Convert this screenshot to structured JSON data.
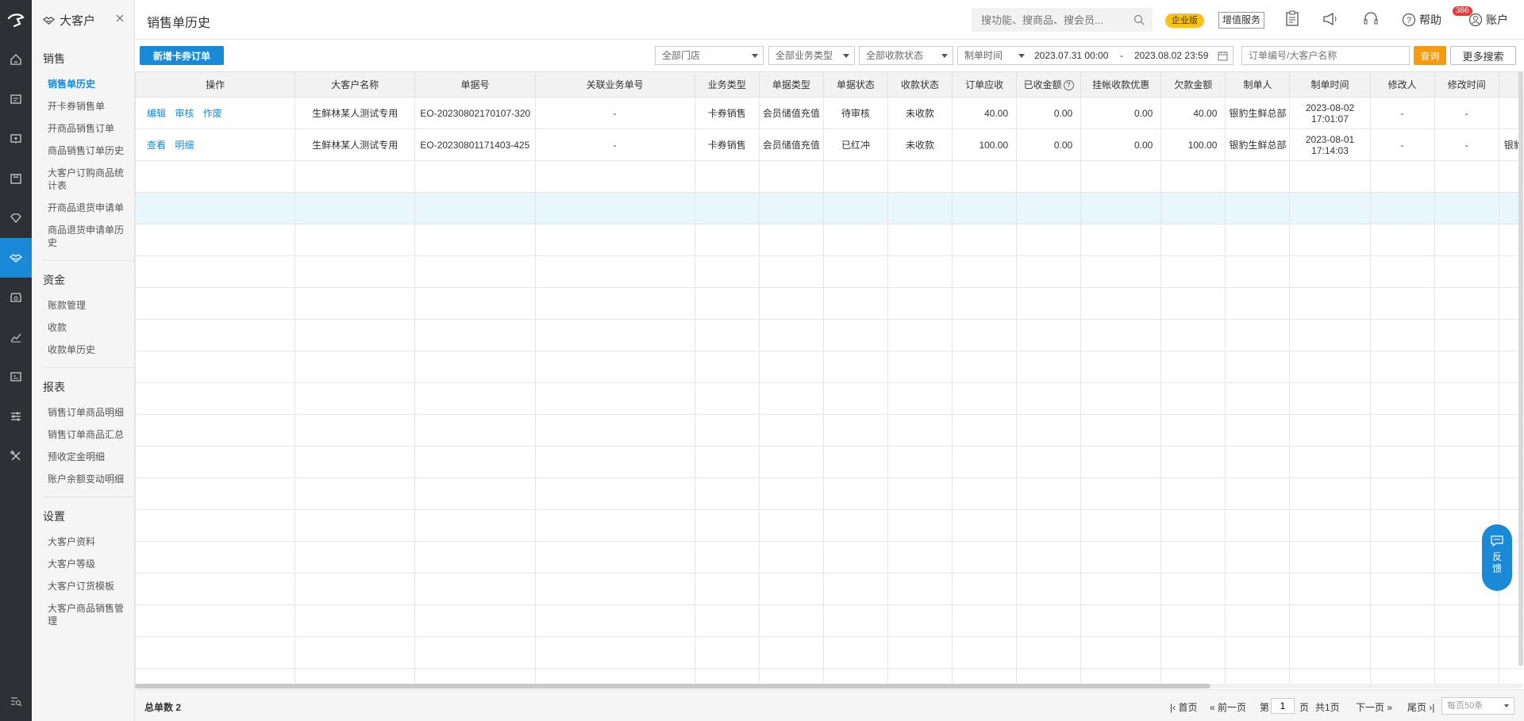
{
  "sidebar": {
    "header_title": "大客户",
    "groups": [
      {
        "title": "销售",
        "items": [
          "销售单历史",
          "开卡券销售单",
          "开商品销售订单",
          "商品销售订单历史",
          "大客户订购商品统计表",
          "开商品退货申请单",
          "商品退货申请单历史"
        ]
      },
      {
        "title": "资金",
        "items": [
          "账款管理",
          "收款",
          "收款单历史"
        ]
      },
      {
        "title": "报表",
        "items": [
          "销售订单商品明细",
          "销售订单商品汇总",
          "预收定金明细",
          "账户余额变动明细"
        ]
      },
      {
        "title": "设置",
        "items": [
          "大客户资料",
          "大客户等级",
          "大客户订货模板",
          "大客户商品销售管理"
        ]
      }
    ]
  },
  "header": {
    "page_title": "销售单历史",
    "search_placeholder": "搜功能、搜商品、搜会员...",
    "edition_badge": "企业版",
    "value_added": "增值服务",
    "notification_count": "386",
    "help": "帮助",
    "account": "账户"
  },
  "filters": {
    "new_button": "新增卡券订单",
    "store": "全部门店",
    "biz_type": "全部业务类型",
    "pay_status": "全部收款状态",
    "date_label": "制单时间",
    "date_start": "2023.07.31 00:00",
    "date_sep": "-",
    "date_end": "2023.08.02 23:59",
    "keyword_placeholder": "订单编号/大客户名称",
    "query": "查询",
    "more": "更多搜索"
  },
  "table": {
    "columns": [
      "操作",
      "大客户名称",
      "单据号",
      "关联业务单号",
      "业务类型",
      "单据类型",
      "单据状态",
      "收款状态",
      "订单应收",
      "已收金额",
      "挂帐收款优惠",
      "欠款金额",
      "制单人",
      "制单时间",
      "修改人",
      "修改时间",
      "审"
    ],
    "rows": [
      {
        "ops": [
          "编辑",
          "审核",
          "作废"
        ],
        "customer": "生鲜林某人测试专用",
        "doc_no": "EO-20230802170107-320",
        "related": "-",
        "biz_type": "卡券销售",
        "doc_type": "会员储值充值",
        "doc_status": "待审核",
        "pay_status": "未收款",
        "receivable": "40.00",
        "received": "0.00",
        "discount": "0.00",
        "owed": "40.00",
        "maker": "银豹生鲜总部",
        "make_date": "2023-08-02",
        "make_time": "17:01:07",
        "modifier": "-",
        "modify_time": "-",
        "auditor": ""
      },
      {
        "ops": [
          "查看",
          "明细"
        ],
        "customer": "生鲜林某人测试专用",
        "doc_no": "EO-20230801171403-425",
        "related": "-",
        "biz_type": "卡券销售",
        "doc_type": "会员储值充值",
        "doc_status": "已红冲",
        "pay_status": "未收款",
        "receivable": "100.00",
        "received": "0.00",
        "discount": "0.00",
        "owed": "100.00",
        "maker": "银豹生鲜总部",
        "make_date": "2023-08-01",
        "make_time": "17:14:03",
        "modifier": "-",
        "modify_time": "-",
        "auditor": "银豹"
      }
    ]
  },
  "footer": {
    "total_label": "总单数",
    "total_value": "2",
    "first": "首页",
    "prev": "前一页",
    "page_prefix": "第",
    "page_value": "1",
    "page_suffix": "页",
    "total_pages": "共1页",
    "next": "下一页",
    "last": "尾页",
    "page_size": "每页50条"
  },
  "feedback": {
    "line1": "反",
    "line2": "馈"
  },
  "colors": {
    "accent": "#1a8ad8",
    "rail": "#2d3035",
    "query": "#f39c12",
    "badge": "#f7c21b",
    "highlight_row": "#e8f7fc"
  },
  "icons": [
    "logo-icon",
    "home-icon",
    "document-icon",
    "monitor-icon",
    "box-icon",
    "diamond-icon",
    "handshake-icon",
    "store-icon",
    "chart-icon",
    "id-card-icon",
    "sliders-icon",
    "tools-icon",
    "search-menu-icon",
    "search-icon",
    "clipboard-icon",
    "megaphone-icon",
    "headset-icon",
    "help-icon",
    "user-icon",
    "calendar-icon",
    "chat-icon"
  ]
}
